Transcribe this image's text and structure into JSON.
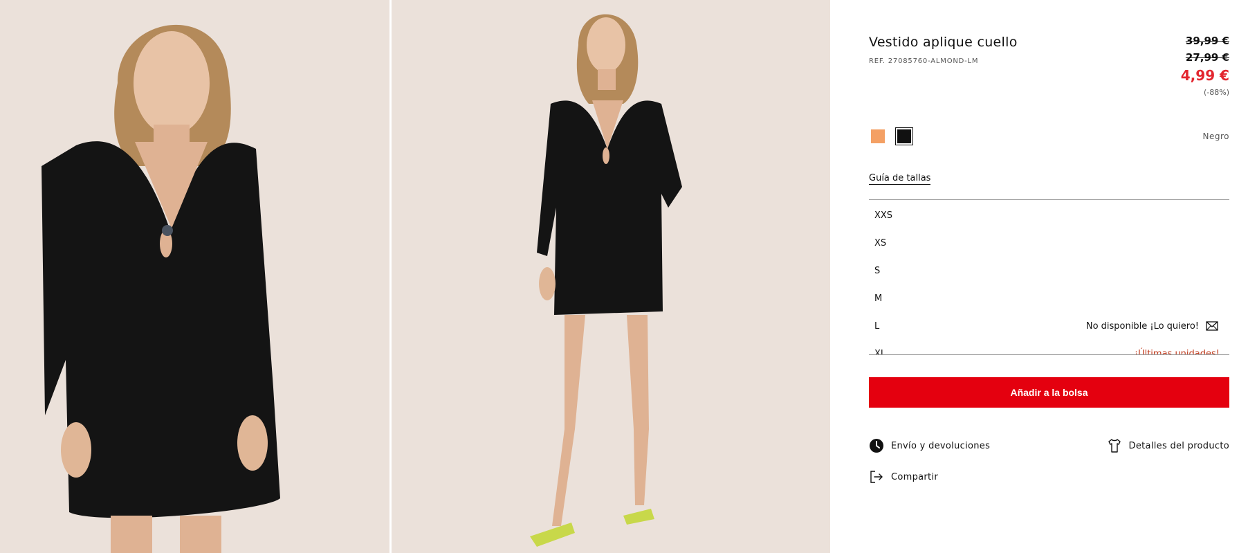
{
  "product": {
    "title": "Vestido aplique cuello",
    "ref": "REF. 27085760-ALMOND-LM",
    "price_original": "39,99 €",
    "price_previous": "27,99 €",
    "price_current": "4,99 €",
    "discount": "(-88%)"
  },
  "colors": {
    "options": [
      {
        "name": "orange-swatch",
        "hex": "#f4a064"
      },
      {
        "name": "black-swatch",
        "hex": "#111111"
      }
    ],
    "selected_label": "Negro"
  },
  "size_guide_label": "Guía de tallas",
  "sizes": [
    {
      "label": "XXS",
      "status": ""
    },
    {
      "label": "XS",
      "status": ""
    },
    {
      "label": "S",
      "status": ""
    },
    {
      "label": "M",
      "status": ""
    },
    {
      "label": "L",
      "status": "No disponible ¡Lo quiero!"
    },
    {
      "label": "XL",
      "status": "¡Últimas unidades!"
    }
  ],
  "add_to_bag_label": "Añadir a la bolsa",
  "links": {
    "shipping": "Envío y devoluciones",
    "details": "Detalles del producto",
    "share": "Compartir"
  },
  "theme": {
    "accent": "#e4000f",
    "sale_price": "#e3262f",
    "warning": "#c0391b",
    "photo_bg": "#ebe1da"
  },
  "icons": {
    "shipping": "clock-icon",
    "details": "tshirt-icon",
    "share": "share-arrow-icon",
    "notify": "envelope-icon"
  }
}
